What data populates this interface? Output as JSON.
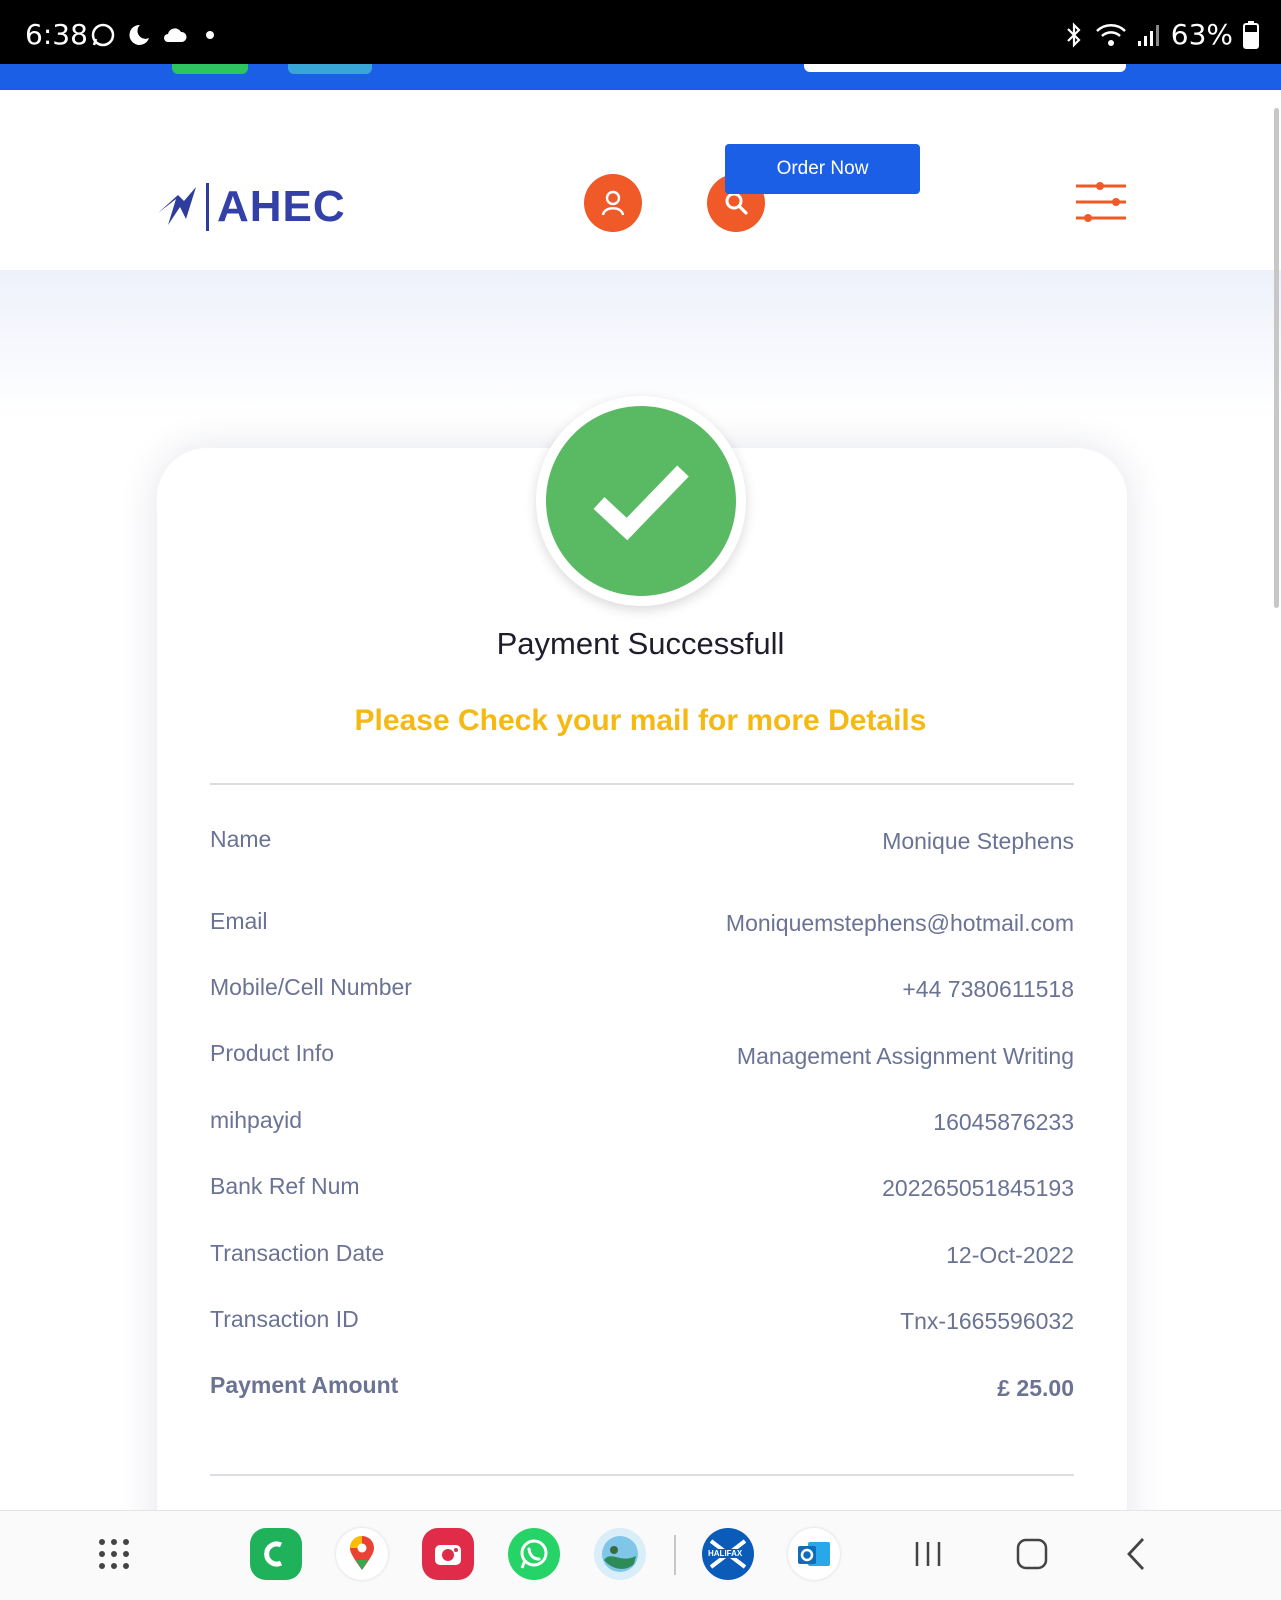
{
  "status_bar": {
    "time": "6:38",
    "battery": "63%"
  },
  "header": {
    "logo_text": "AHEC",
    "order_button": "Order Now"
  },
  "payment": {
    "title": "Payment Successfull",
    "subtitle": "Please Check your mail for more Details",
    "rows": [
      {
        "label": "Name",
        "value": "Monique Stephens"
      },
      {
        "label": "Email",
        "value": "Moniquemstephens@hotmail.com"
      },
      {
        "label": "Mobile/Cell Number",
        "value": "+44 7380611518"
      },
      {
        "label": "Product Info",
        "value": "Management Assignment Writing"
      },
      {
        "label": "mihpayid",
        "value": "16045876233"
      },
      {
        "label": "Bank Ref Num",
        "value": "202265051845193"
      },
      {
        "label": "Transaction Date",
        "value": "12-Oct-2022"
      },
      {
        "label": "Transaction ID",
        "value": "Tnx-1665596032"
      },
      {
        "label": "Payment Amount",
        "value": "£ 25.00"
      }
    ]
  },
  "navbar": {
    "apps": [
      "apps-grid-icon",
      "call-app-icon",
      "maps-icon",
      "camera-icon",
      "whatsapp-icon",
      "gallery-icon",
      "halifax-icon",
      "outlook-icon"
    ],
    "halifax_label": "HALIFAX"
  },
  "colors": {
    "brand_blue": "#1a5fe6",
    "accent_orange": "#ef5a28",
    "success_green": "#5aba63",
    "highlight_yellow": "#f5b914"
  }
}
